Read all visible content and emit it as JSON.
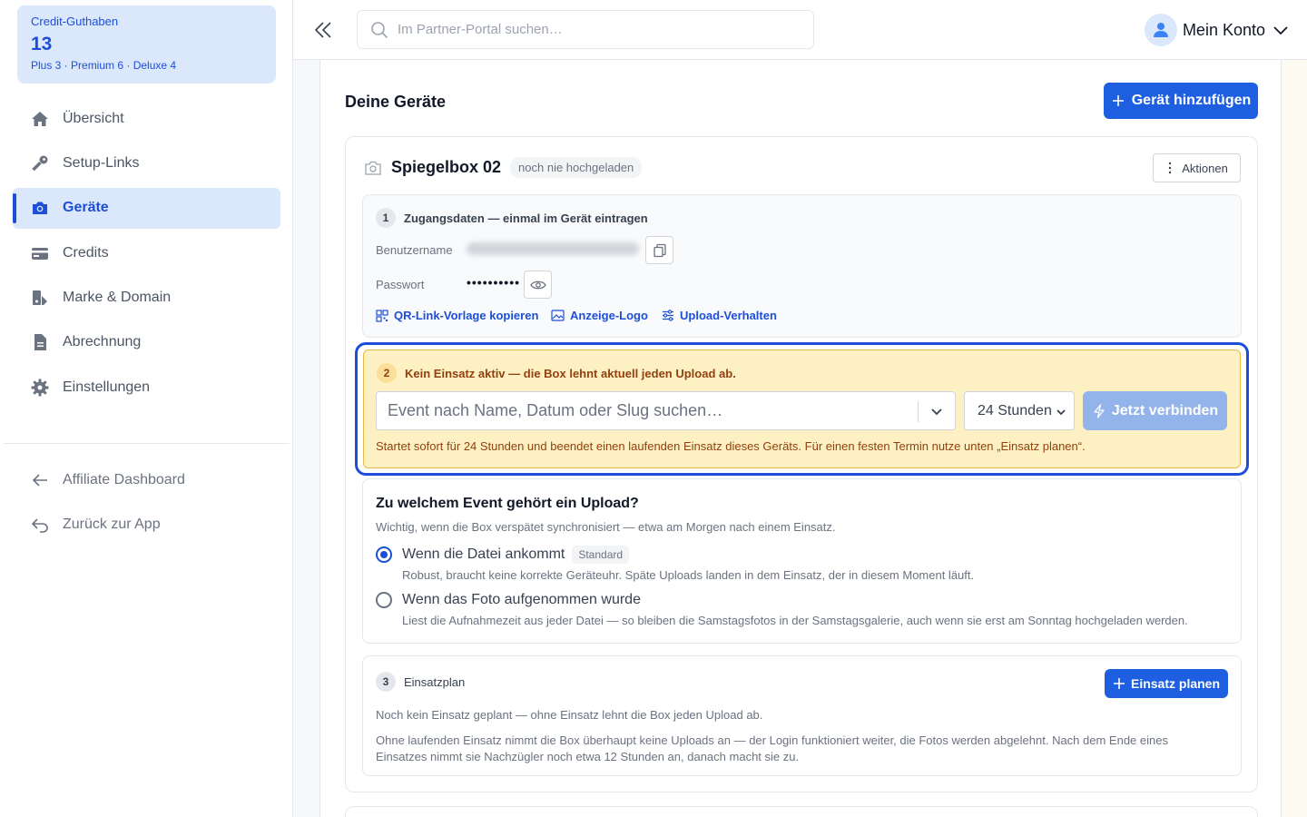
{
  "sidebar": {
    "credit": {
      "label": "Credit-Guthaben",
      "count": "13",
      "breakdown": "Plus 3 · Premium 6 · Deluxe 4"
    },
    "nav": [
      {
        "label": "Übersicht",
        "icon": "home-icon"
      },
      {
        "label": "Setup-Links",
        "icon": "key-icon"
      },
      {
        "label": "Geräte",
        "icon": "camera-icon",
        "active": true
      },
      {
        "label": "Credits",
        "icon": "credit-card-icon"
      },
      {
        "label": "Marke & Domain",
        "icon": "brand-icon"
      },
      {
        "label": "Abrechnung",
        "icon": "document-icon"
      },
      {
        "label": "Einstellungen",
        "icon": "gear-icon"
      }
    ],
    "secondary": [
      {
        "label": "Affiliate Dashboard",
        "icon": "arrow-left-icon"
      },
      {
        "label": "Zurück zur App",
        "icon": "return-icon"
      }
    ]
  },
  "topbar": {
    "search_placeholder": "Im Partner-Portal suchen…",
    "account_label": "Mein Konto"
  },
  "main": {
    "title": "Deine Geräte",
    "add_button": "Gerät hinzufügen",
    "device": {
      "name": "Spiegelbox 02",
      "status_badge": "noch nie hochgeladen",
      "actions_label": "Aktionen",
      "credentials": {
        "step": "1",
        "title": "Zugangsdaten — einmal im Gerät eintragen",
        "username_label": "Benutzername",
        "password_label": "Passwort",
        "password_value": "••••••••••",
        "links": [
          "QR-Link-Vorlage kopieren",
          "Anzeige-Logo",
          "Upload-Verhalten"
        ]
      },
      "activation": {
        "step": "2",
        "warning": "Kein Einsatz aktiv — die Box lehnt aktuell jeden Upload ab.",
        "event_placeholder": "Event nach Name, Datum oder Slug suchen…",
        "duration": "24 Stunden",
        "connect_button": "Jetzt verbinden",
        "hint": "Startet sofort für 24 Stunden und beendet einen laufenden Einsatz dieses Geräts. Für einen festen Termin nutze unten „Einsatz planen“."
      },
      "upload_assignment": {
        "title": "Zu welchem Event gehört ein Upload?",
        "subtitle": "Wichtig, wenn die Box verspätet synchronisiert — etwa am Morgen nach einem Einsatz.",
        "options": [
          {
            "label": "Wenn die Datei ankommt",
            "badge": "Standard",
            "selected": true,
            "description": "Robust, braucht keine korrekte Geräteuhr. Späte Uploads landen in dem Einsatz, der in diesem Moment läuft."
          },
          {
            "label": "Wenn das Foto aufgenommen wurde",
            "selected": false,
            "description": "Liest die Aufnahmezeit aus jeder Datei — so bleiben die Samstagsfotos in der Samstagsgalerie, auch wenn sie erst am Sonntag hochgeladen werden."
          }
        ]
      },
      "schedule": {
        "step": "3",
        "title": "Einsatzplan",
        "plan_button": "Einsatz planen",
        "empty_text": "Noch kein Einsatz geplant — ohne Einsatz lehnt die Box jeden Upload ab.",
        "info_text": "Ohne laufenden Einsatz nimmt die Box überhaupt keine Uploads an — der Login funktioniert weiter, die Fotos werden abgelehnt. Nach dem Ende eines Einsatzes nimmt sie Nachzügler noch etwa 12 Stunden an, danach macht sie zu."
      }
    }
  },
  "colors": {
    "accent": "#1d5fe0",
    "warning_bg": "#fdf1c4",
    "warning_text": "#92400e",
    "active_nav_bg": "#dbe8fb"
  }
}
